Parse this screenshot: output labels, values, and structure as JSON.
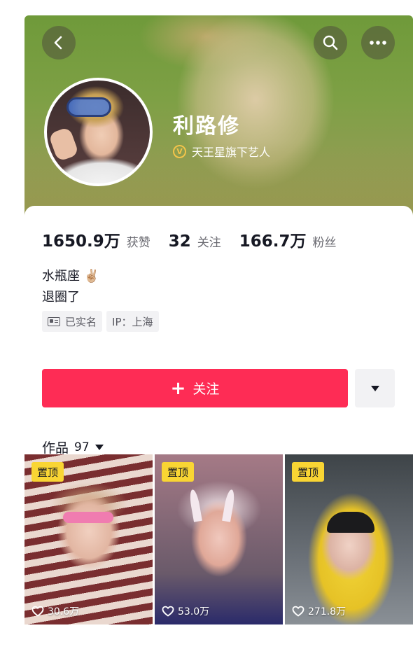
{
  "profile": {
    "name": "利路修",
    "verified_text": "天王星旗下艺人",
    "verified_badge": "V"
  },
  "stats": [
    {
      "value": "1650.9万",
      "label": "获赞"
    },
    {
      "value": "32",
      "label": "关注"
    },
    {
      "value": "166.7万",
      "label": "粉丝"
    }
  ],
  "bio": {
    "line1": "水瓶座 ✌🏼",
    "line2": "退圈了"
  },
  "tags": {
    "realname": "已实名",
    "ip": "IP：上海"
  },
  "actions": {
    "follow_plus": "+",
    "follow_label": "关注"
  },
  "works": {
    "label": "作品",
    "count": "97"
  },
  "videos": [
    {
      "pin": "置顶",
      "likes": "30.6万"
    },
    {
      "pin": "置顶",
      "likes": "53.0万"
    },
    {
      "pin": "置顶",
      "likes": "271.8万"
    }
  ],
  "icons": {
    "back": "back-arrow-icon",
    "search": "search-icon",
    "more": "more-dots-icon",
    "heart": "heart-icon",
    "id_card": "id-card-icon"
  },
  "colors": {
    "follow_button": "#fe2c55",
    "pin_badge": "#f9d533",
    "verify_badge": "#f3c44a"
  }
}
